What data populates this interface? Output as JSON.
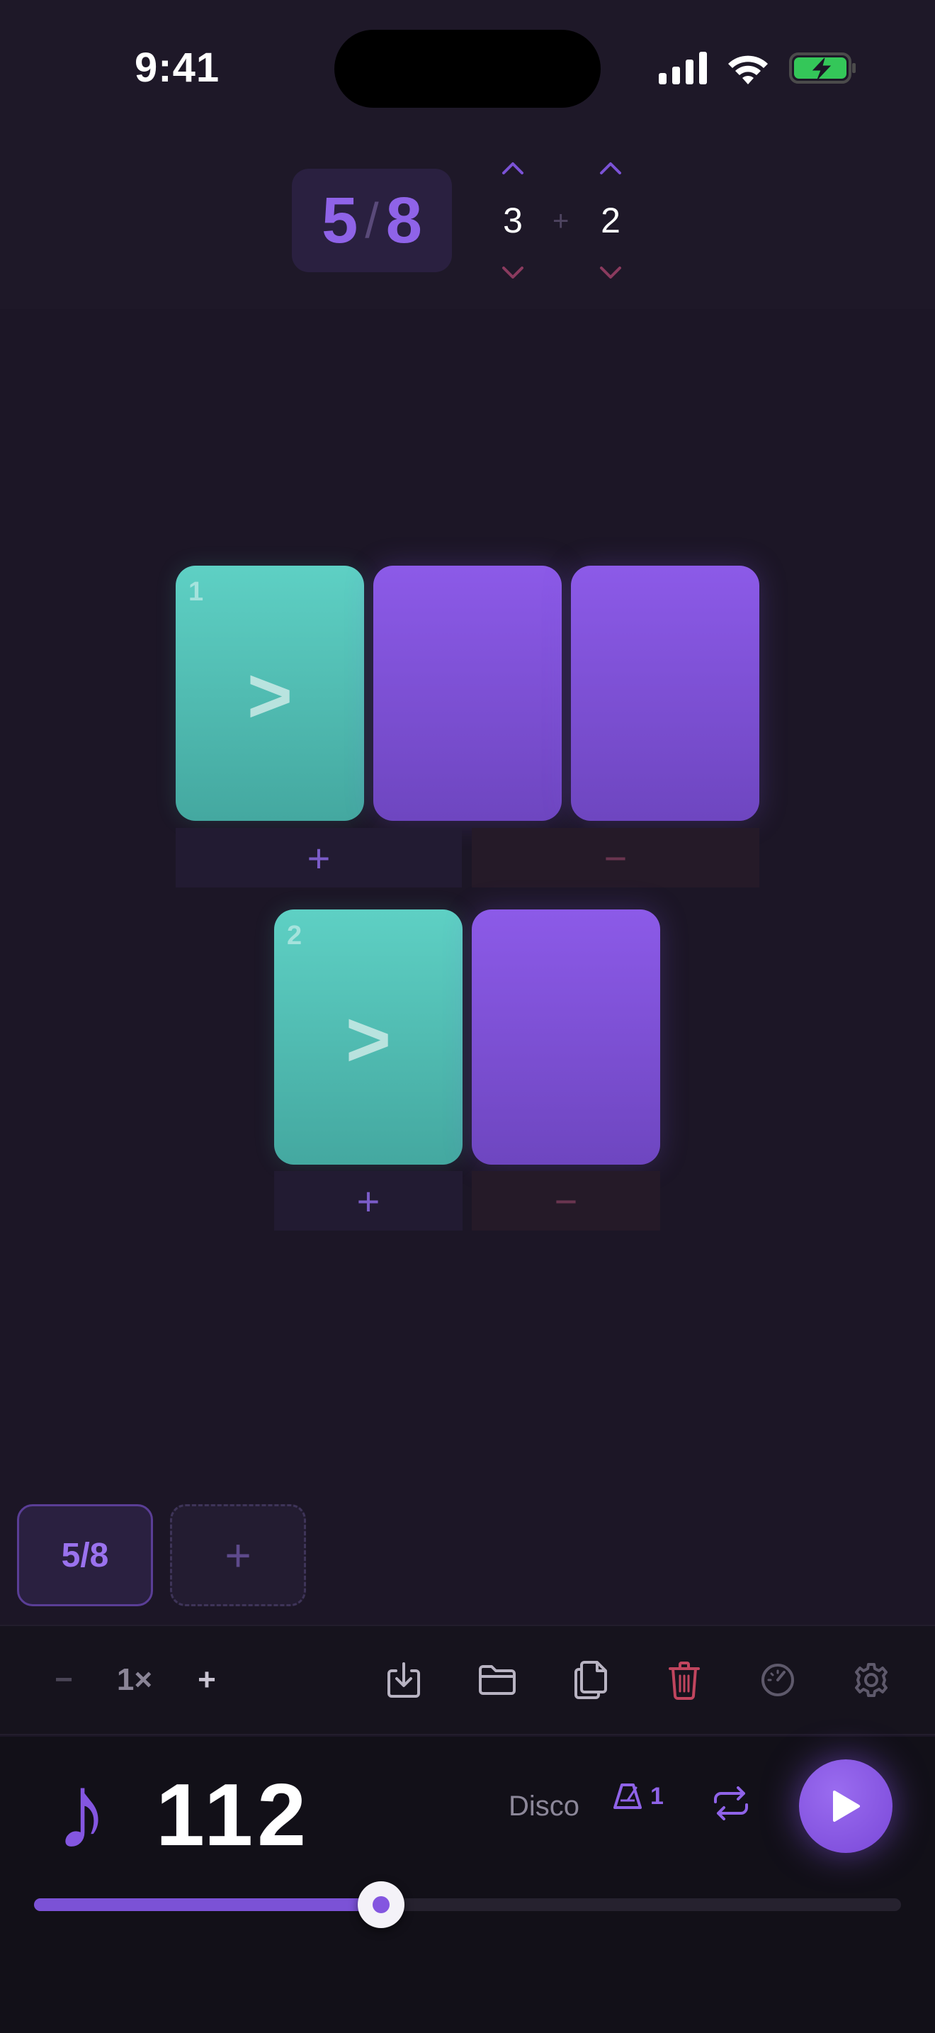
{
  "status_bar": {
    "time": "9:41"
  },
  "header": {
    "signature_numerator": "5",
    "signature_denominator": "8",
    "groups": [
      {
        "value": "3"
      },
      {
        "value": "2"
      }
    ],
    "plus_symbol": "+"
  },
  "beat_groups": [
    {
      "number": "1",
      "beats": 3,
      "accent_symbol": ">",
      "add_label": "+",
      "remove_label": "−"
    },
    {
      "number": "2",
      "beats": 2,
      "accent_symbol": ">",
      "add_label": "+",
      "remove_label": "−"
    }
  ],
  "patterns": {
    "items": [
      {
        "label": "5/8"
      }
    ],
    "add_label": "+"
  },
  "toolbar": {
    "zoom_minus": "−",
    "zoom_value": "1×",
    "zoom_plus": "+",
    "icons": [
      "download-icon",
      "folder-icon",
      "copy-icon",
      "trash-icon",
      "speedometer-icon",
      "gear-icon"
    ]
  },
  "transport": {
    "note_symbol": "♪",
    "bpm": "112",
    "style": "Disco",
    "metronome_count": "1",
    "tempo_fraction": 0.4
  },
  "colors": {
    "accent": "#8456e0",
    "accent_beat": "#5ed0c4",
    "danger": "#c0455e"
  }
}
